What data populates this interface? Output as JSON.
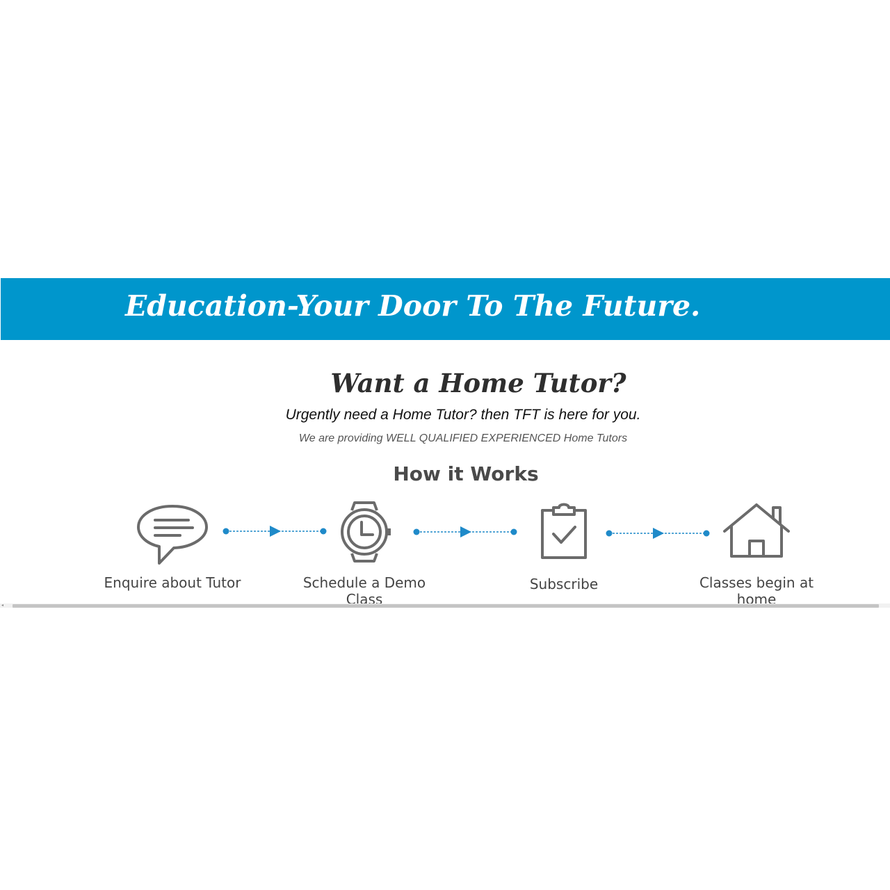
{
  "banner": {
    "title": "Education-Your Door To The Future.",
    "color": "#0096cc"
  },
  "hero": {
    "headline": "Want a Home Tutor?",
    "tagline": "Urgently need a Home Tutor? then TFT is here for you.",
    "subline": "We are providing WELL QUALIFIED EXPERIENCED Home Tutors"
  },
  "how_it_works": {
    "title": "How it Works",
    "accent_color": "#1f8ac9",
    "steps": [
      {
        "icon": "chat-bubble-icon",
        "label": "Enquire about Tutor"
      },
      {
        "icon": "watch-icon",
        "label": "Schedule a Demo Class"
      },
      {
        "icon": "clipboard-check-icon",
        "label": "Subscribe"
      },
      {
        "icon": "house-icon",
        "label": "Classes begin at home"
      }
    ]
  },
  "scrollbar": {
    "left_arrow_icon": "arrow-left-icon"
  }
}
